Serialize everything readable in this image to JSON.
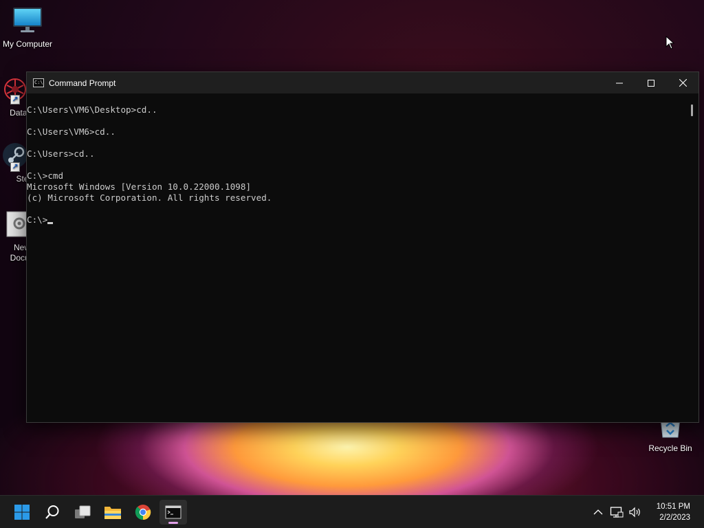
{
  "desktop": {
    "icons": [
      {
        "label": "My Computer",
        "icon": "monitor-icon"
      },
      {
        "label": "DataW",
        "icon": "datawrapper-icon",
        "shortcut": true
      },
      {
        "label": "Ste",
        "icon": "steam-icon",
        "shortcut": true
      },
      {
        "label_line1": "New",
        "label_line2": "Docun",
        "icon": "document-icon"
      },
      {
        "label": "Recycle Bin",
        "icon": "recycle-bin-icon"
      }
    ]
  },
  "cmd_window": {
    "title": "Command Prompt",
    "icon": "cmd-icon",
    "app_icon_text": "C:\\",
    "controls": [
      "minimize-icon",
      "maximize-icon",
      "close-icon"
    ],
    "lines": [
      "C:\\Users\\VM6\\Desktop>cd..",
      "",
      "C:\\Users\\VM6>cd..",
      "",
      "C:\\Users>cd..",
      "",
      "C:\\>cmd",
      "Microsoft Windows [Version 10.0.22000.1098]",
      "(c) Microsoft Corporation. All rights reserved.",
      "",
      "C:\\>"
    ]
  },
  "taskbar": {
    "pinned": [
      {
        "name": "start-button",
        "icon": "windows-logo-icon"
      },
      {
        "name": "search-button",
        "icon": "search-icon"
      },
      {
        "name": "task-view-button",
        "icon": "task-view-icon"
      },
      {
        "name": "file-explorer-button",
        "icon": "folder-icon"
      },
      {
        "name": "chrome-button",
        "icon": "chrome-icon"
      },
      {
        "name": "command-prompt-taskbar-button",
        "icon": "cmd-icon",
        "active": true
      }
    ],
    "tray": {
      "icons": [
        "chevron-up-icon",
        "network-icon",
        "volume-icon"
      ],
      "time": "10:51 PM",
      "date": "2/2/2023"
    }
  },
  "colors": {
    "console_bg": "#0c0c0c",
    "console_text": "#cccccc",
    "titlebar_bg": "#1f1f1f",
    "taskbar_bg": "#1c1c1c",
    "windows_blue": "#2b9ae8"
  }
}
